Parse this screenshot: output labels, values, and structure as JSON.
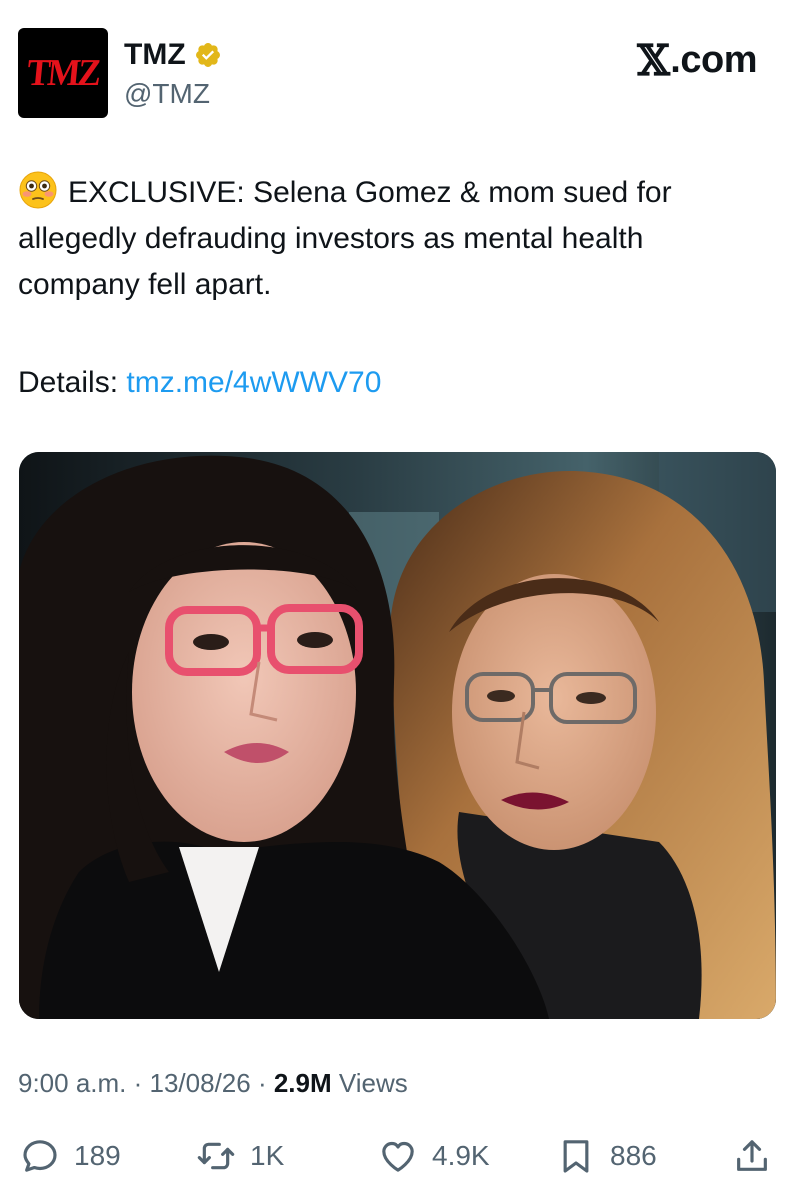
{
  "account": {
    "avatar_text": "TMZ",
    "display_name": "TMZ",
    "handle": "@TMZ",
    "verified": true
  },
  "brand": {
    "x_glyph": "𝕏",
    "suffix": ".com"
  },
  "tweet": {
    "emoji": "flushed-face",
    "text": "EXCLUSIVE: Selena Gomez & mom sued for allegedly defrauding investors as mental health company fell apart.",
    "details_label": "Details: ",
    "link_text": "tmz.me/4wWWV70"
  },
  "meta": {
    "time": "9:00 a.m.",
    "separator": " · ",
    "date": "13/08/26",
    "views_count": "2.9M",
    "views_label": " Views"
  },
  "actions": {
    "replies": "189",
    "reposts": "1K",
    "likes": "4.9K",
    "bookmarks": "886"
  },
  "colors": {
    "link": "#1d9bf0",
    "muted": "#536471",
    "text": "#0f1419",
    "tmz_red": "#e4121b",
    "verified_gold": "#e2b719"
  }
}
